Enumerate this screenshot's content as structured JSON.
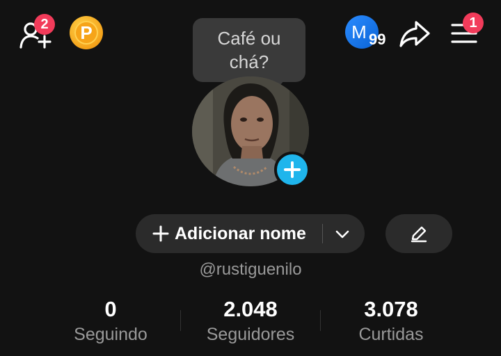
{
  "header": {
    "add_friends_badge": "2",
    "coin_letter": "P",
    "account_initial": "M",
    "account_count": "99",
    "menu_badge": "1"
  },
  "profile": {
    "tooltip_line1": "Café ou",
    "tooltip_line2": "chá?",
    "add_name_label": "Adicionar nome",
    "username": "@rustiguenilo"
  },
  "stats": [
    {
      "value": "0",
      "label": "Seguindo"
    },
    {
      "value": "2.048",
      "label": "Seguidores"
    },
    {
      "value": "3.078",
      "label": "Curtidas"
    }
  ],
  "colors": {
    "background": "#121212",
    "badge": "#f23b5a",
    "accent_blue": "#1fb5ec",
    "pill": "#2b2b2b"
  },
  "icons": [
    "add-friend-icon",
    "coin-icon",
    "share-icon",
    "menu-icon",
    "plus-icon",
    "chevron-down-icon",
    "pencil-icon"
  ]
}
